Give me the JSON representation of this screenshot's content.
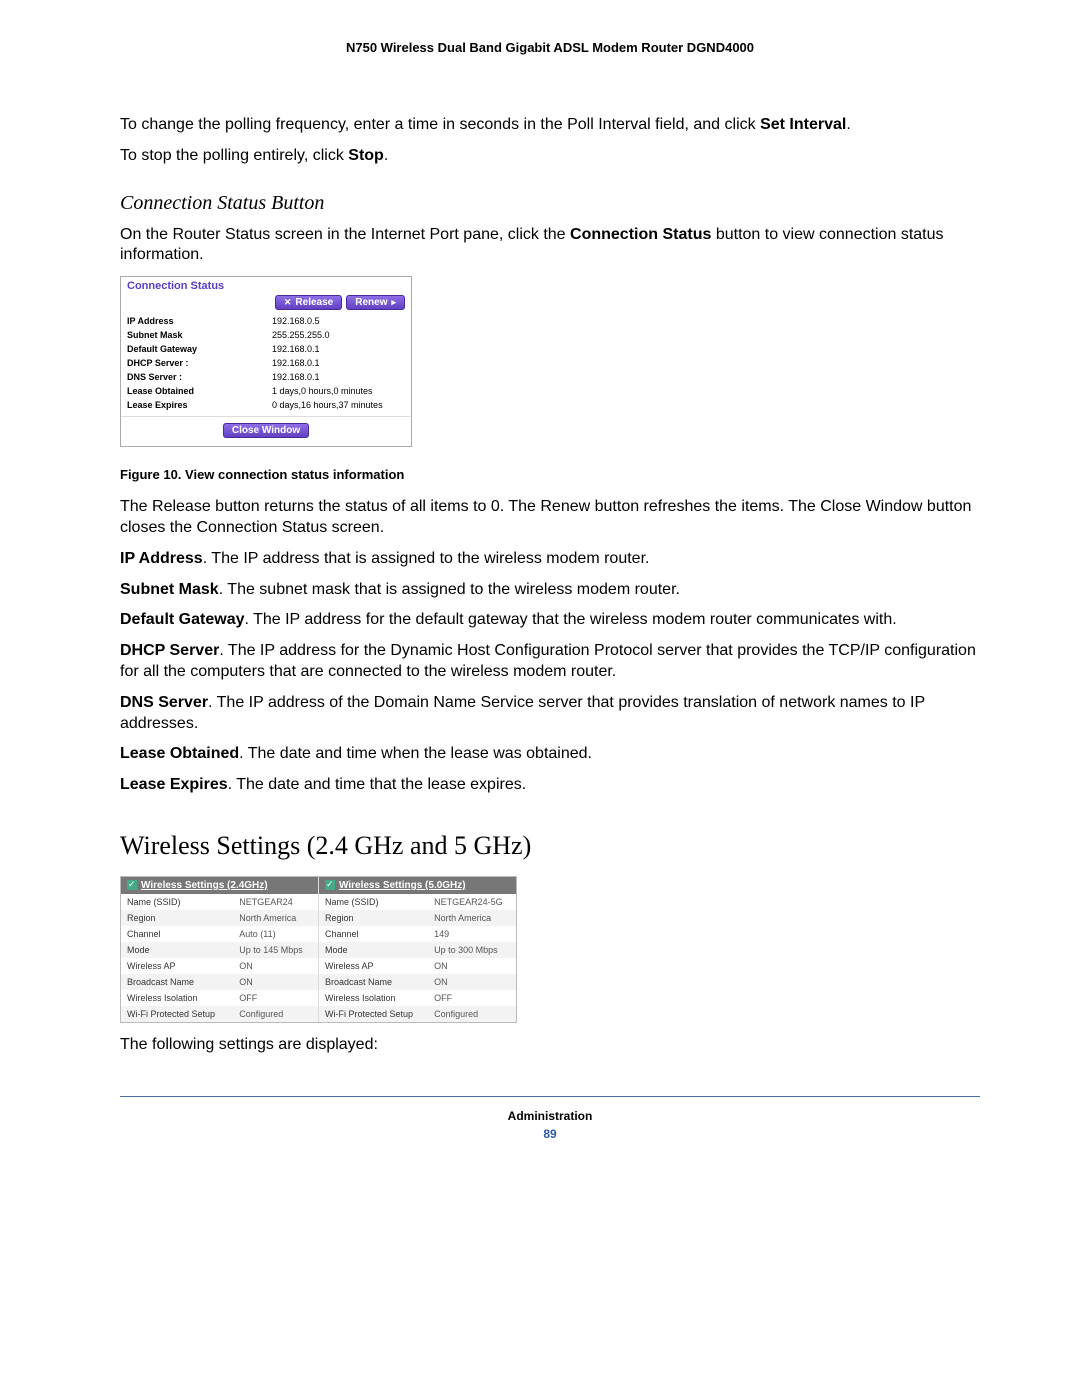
{
  "header": {
    "title": "N750 Wireless Dual Band Gigabit ADSL Modem Router DGND4000"
  },
  "intro": {
    "para1_a": "To change the polling frequency, enter a time in seconds in the Poll Interval field, and click ",
    "para1_b": "Set Interval",
    "para1_c": ".",
    "para2_a": "To stop the polling entirely, click ",
    "para2_b": "Stop",
    "para2_c": "."
  },
  "conn": {
    "heading": "Connection Status Button",
    "desc_a": "On the Router Status screen in the Internet Port pane, click the ",
    "desc_b": "Connection Status",
    "desc_c": " button to view connection status information.",
    "box_title": "Connection Status",
    "release_label": "Release",
    "renew_label": "Renew",
    "rows": [
      {
        "label": "IP Address",
        "value": "192.168.0.5"
      },
      {
        "label": "Subnet Mask",
        "value": "255.255.255.0"
      },
      {
        "label": "Default Gateway",
        "value": "192.168.0.1"
      },
      {
        "label": "DHCP Server :",
        "value": "192.168.0.1"
      },
      {
        "label": "DNS Server :",
        "value": "192.168.0.1"
      },
      {
        "label": "Lease Obtained",
        "value": "1 days,0 hours,0 minutes"
      },
      {
        "label": "Lease Expires",
        "value": "0 days,16 hours,37 minutes"
      }
    ],
    "close_label": "Close Window",
    "figure_caption": "Figure 10. View connection status information",
    "after_para": "The Release button returns the status of all items to 0. The Renew button refreshes the items. The Close Window button closes the Connection Status screen.",
    "defs": [
      {
        "term": "IP Address",
        "text": ". The IP address that is assigned to the wireless modem router."
      },
      {
        "term": "Subnet Mask",
        "text": ". The subnet mask that is assigned to the wireless modem router."
      },
      {
        "term": "Default Gateway",
        "text": ". The IP address for the default gateway that the wireless modem router communicates with."
      },
      {
        "term": "DHCP Server",
        "text": ". The IP address for the Dynamic Host Configuration Protocol server that provides the TCP/IP configuration for all the computers that are connected to the wireless modem router."
      },
      {
        "term": "DNS Server",
        "text": ". The IP address of the Domain Name Service server that provides translation of network names to IP addresses."
      },
      {
        "term": "Lease Obtained",
        "text": ". The date and time when the lease was obtained."
      },
      {
        "term": "Lease Expires",
        "text": ". The date and time that the lease expires."
      }
    ]
  },
  "wifi": {
    "heading": "Wireless Settings (2.4 GHz and 5 GHz)",
    "col24_title": "Wireless Settings (2.4GHz)",
    "col5_title": "Wireless Settings (5.0GHz)",
    "rows24": [
      {
        "label": "Name (SSID)",
        "value": "NETGEAR24"
      },
      {
        "label": "Region",
        "value": "North America"
      },
      {
        "label": "Channel",
        "value": "Auto (11)"
      },
      {
        "label": "Mode",
        "value": "Up to 145 Mbps"
      },
      {
        "label": "Wireless AP",
        "value": "ON"
      },
      {
        "label": "Broadcast Name",
        "value": "ON"
      },
      {
        "label": "Wireless Isolation",
        "value": "OFF"
      },
      {
        "label": "Wi-Fi Protected Setup",
        "value": "Configured"
      }
    ],
    "rows5": [
      {
        "label": "Name (SSID)",
        "value": "NETGEAR24-5G"
      },
      {
        "label": "Region",
        "value": "North America"
      },
      {
        "label": "Channel",
        "value": "149"
      },
      {
        "label": "Mode",
        "value": "Up to 300 Mbps"
      },
      {
        "label": "Wireless AP",
        "value": "ON"
      },
      {
        "label": "Broadcast Name",
        "value": "ON"
      },
      {
        "label": "Wireless Isolation",
        "value": "OFF"
      },
      {
        "label": "Wi-Fi Protected Setup",
        "value": "Configured"
      }
    ],
    "after": "The following settings are displayed:"
  },
  "footer": {
    "chapter": "Administration",
    "page": "89"
  }
}
